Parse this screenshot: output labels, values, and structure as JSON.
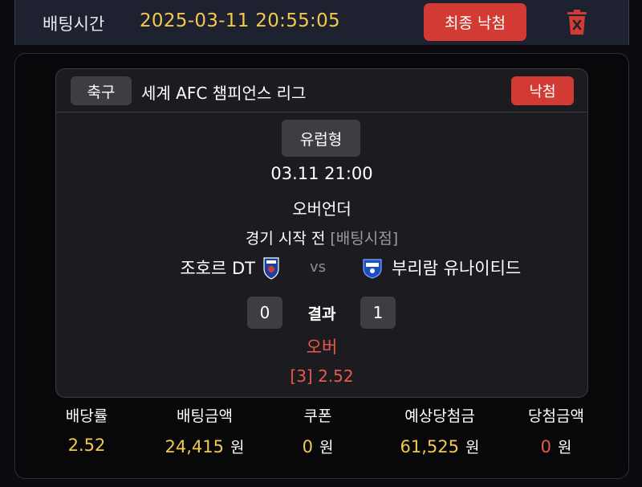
{
  "header": {
    "bet_time_label": "배팅시간",
    "bet_time_value": "2025-03-11 20:55:05",
    "final_button": "최종 낙첨",
    "delete_icon": "trash-icon"
  },
  "bet_card": {
    "sport": "축구",
    "league": "세계 AFC 챔피언스 리그",
    "result_badge": "낙첨",
    "bet_type": "유럽형",
    "match_time": "03.11 21:00",
    "market": "오버언더",
    "status": "경기 시작 전",
    "bet_point": "[배팅시점]",
    "home_team": "조호르 DT",
    "vs": "vs",
    "away_team": "부리람 유나이티드",
    "home_score": "0",
    "result_label": "결과",
    "away_score": "1",
    "pick": "오버",
    "odds_line": "[3] 2.52"
  },
  "summary": {
    "odds_label": "배당률",
    "odds_value": "2.52",
    "bet_amount_label": "배팅금액",
    "bet_amount_value": "24,415",
    "bet_amount_unit": "원",
    "coupon_label": "쿠폰",
    "coupon_value": "0",
    "coupon_unit": "원",
    "expected_win_label": "예상당첨금",
    "expected_win_value": "61,525",
    "expected_win_unit": "원",
    "win_amount_label": "당첨금액",
    "win_amount_value": "0",
    "win_amount_unit": "원"
  },
  "colors": {
    "accent_red": "#d23b34",
    "accent_yellow": "#f2c94c",
    "pick_red": "#e8584b"
  }
}
